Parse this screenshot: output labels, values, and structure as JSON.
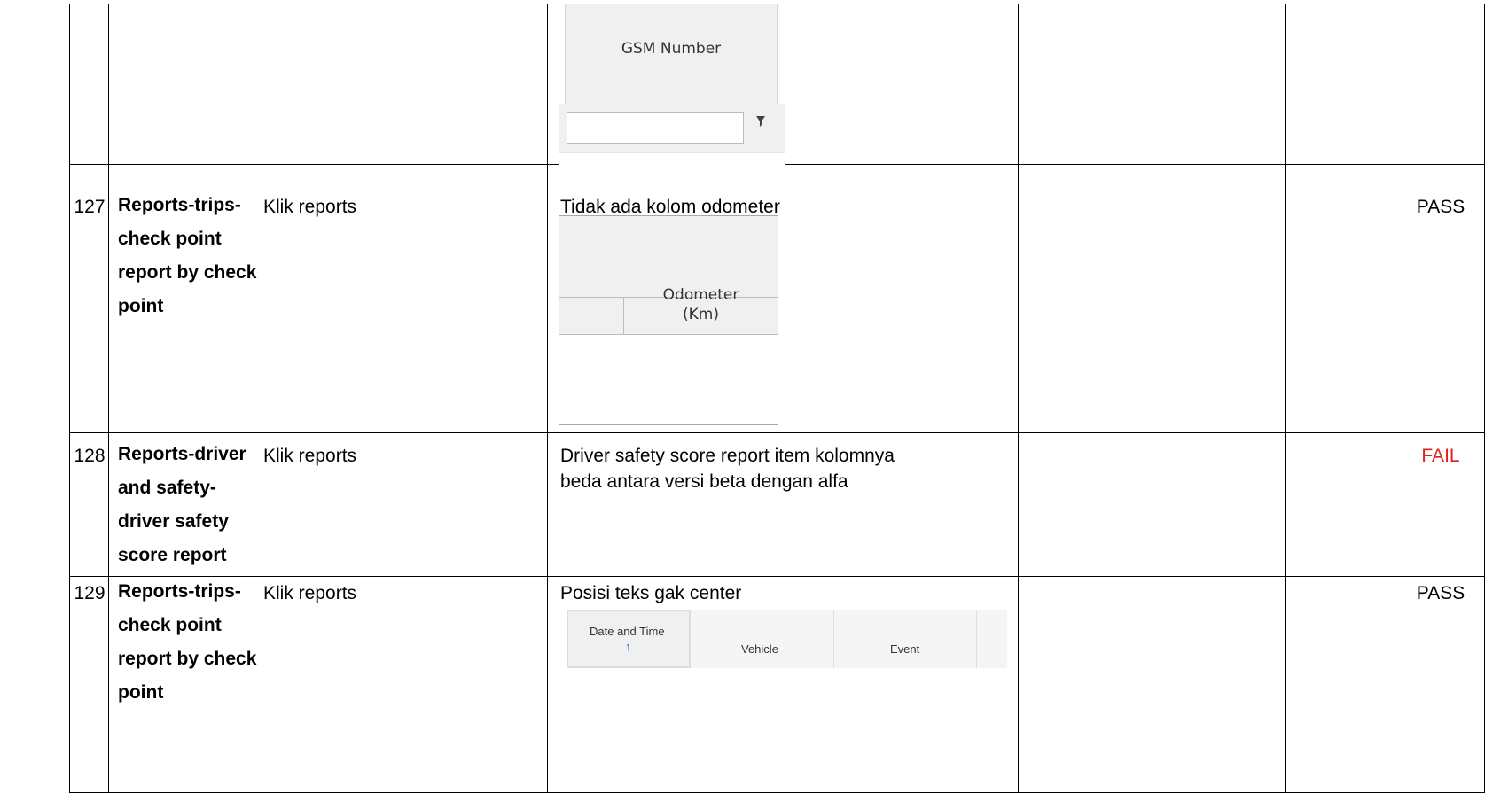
{
  "rows": [
    {
      "no": "",
      "title_lines": [],
      "step": "",
      "result_lines": [],
      "status": ""
    },
    {
      "no": "127",
      "title_lines": [
        "Reports-trips-",
        "check point",
        "report by check",
        "point"
      ],
      "step": "Klik reports",
      "result_lines": [
        "Tidak ada kolom odometer"
      ],
      "status": "PASS"
    },
    {
      "no": "128",
      "title_lines": [
        "Reports-driver",
        "and safety-",
        "driver safety",
        "score report"
      ],
      "step": "Klik reports",
      "result_lines": [
        "Driver safety score report item kolomnya",
        "beda antara versi beta dengan alfa"
      ],
      "status": "FAIL"
    },
    {
      "no": "129",
      "title_lines": [
        "Reports-trips-",
        "check point",
        "report by check",
        "point"
      ],
      "step": "Klik reports",
      "result_lines": [
        "Posisi teks gak center"
      ],
      "status": "PASS"
    }
  ],
  "screenshots": {
    "gsm": {
      "column_header": "GSM Number",
      "filter_value": "",
      "filter_icon": "filter-icon"
    },
    "odometer": {
      "column_header": "Odometer\n(Km)"
    },
    "date_time": {
      "columns": [
        "Date and Time",
        "Vehicle",
        "Event"
      ],
      "sort_arrow": "↑",
      "sort_icon": "sort-ascending-icon"
    }
  },
  "colors": {
    "fail": "#e0211a",
    "pass": "#000000",
    "link_blue": "#1a73e8"
  }
}
